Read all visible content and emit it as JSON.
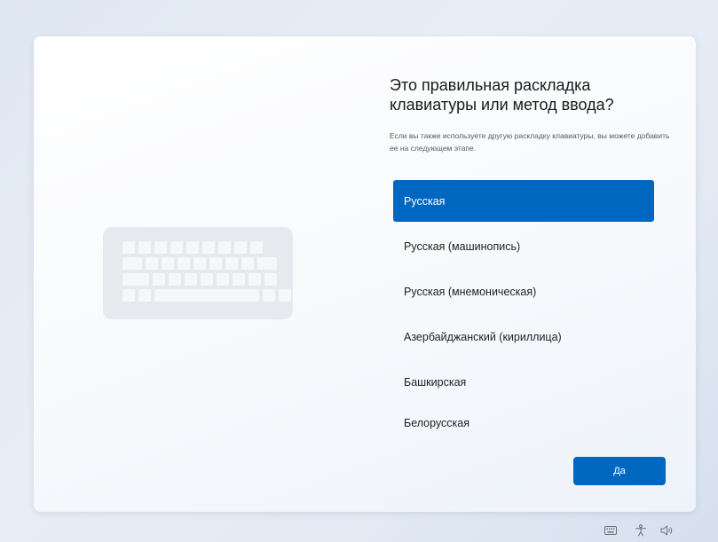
{
  "setup": {
    "title": "Это правильная раскладка клавиатуры или метод ввода?",
    "subtitle": "Если вы также используете другую раскладку клавиатуры, вы можете добавить ее на следующем этапе.",
    "layouts": [
      {
        "label": "Русская",
        "selected": true
      },
      {
        "label": "Русская (машинопись)",
        "selected": false
      },
      {
        "label": "Русская (мнемоническая)",
        "selected": false
      },
      {
        "label": "Азербайджанский (кириллица)",
        "selected": false
      },
      {
        "label": "Башкирская",
        "selected": false
      },
      {
        "label": "Белорусская",
        "selected": false
      }
    ],
    "yes_button": "Да"
  },
  "colors": {
    "accent": "#0067c0",
    "background": "#e3eaf4",
    "card": "#ffffff"
  },
  "illustration": {
    "icon": "keyboard-illustration"
  },
  "taskbar": {
    "icons": [
      "keyboard-icon",
      "accessibility-icon",
      "volume-icon"
    ]
  }
}
